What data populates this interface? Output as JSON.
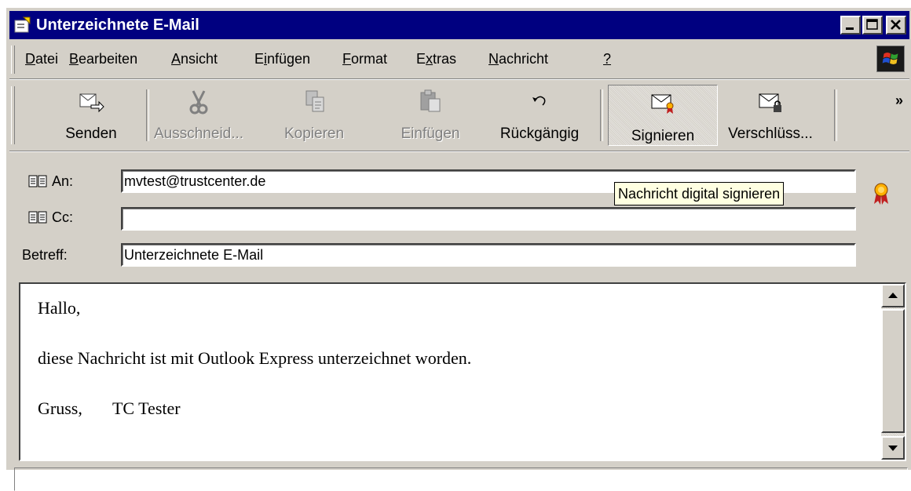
{
  "window": {
    "title": "Unterzeichnete E-Mail",
    "buttons": {
      "minimize": "_",
      "maximize": "□",
      "close": "×"
    }
  },
  "menu": [
    {
      "label": "Datei",
      "ul": "D",
      "rest": "atei"
    },
    {
      "label": "Bearbeiten",
      "ul": "B",
      "rest": "earbeiten"
    },
    {
      "label": "Ansicht",
      "ul": "A",
      "rest": "nsicht"
    },
    {
      "label": "Einfügen",
      "pre": "E",
      "ul": "i",
      "rest": "nfügen"
    },
    {
      "label": "Format",
      "ul": "F",
      "rest": "ormat"
    },
    {
      "label": "Extras",
      "pre": "E",
      "ul": "x",
      "rest": "tras"
    },
    {
      "label": "Nachricht",
      "ul": "N",
      "rest": "achricht"
    },
    {
      "label": "?",
      "ul": "?",
      "rest": ""
    }
  ],
  "toolbar": {
    "send": "Senden",
    "cut": "Ausschneid...",
    "copy": "Kopieren",
    "paste": "Einfügen",
    "undo": "Rückgängig",
    "sign": "Signieren",
    "encrypt": "Verschlüss...",
    "more": "»"
  },
  "header": {
    "to_label": "An:",
    "to_value": "mvtest@trustcenter.de",
    "cc_label": "Cc:",
    "cc_value": "",
    "subject_label": "Betreff:",
    "subject_value": "Unterzeichnete E-Mail"
  },
  "tooltip": "Nachricht digital signieren",
  "body": {
    "line1": "Hallo,",
    "line2": "diese Nachricht ist mit Outlook Express unterzeichnet worden.",
    "line3": "Gruss,       TC Tester"
  },
  "colors": {
    "title_bar": "#000080",
    "face": "#d4d0c8",
    "tooltip": "#ffffe1"
  }
}
